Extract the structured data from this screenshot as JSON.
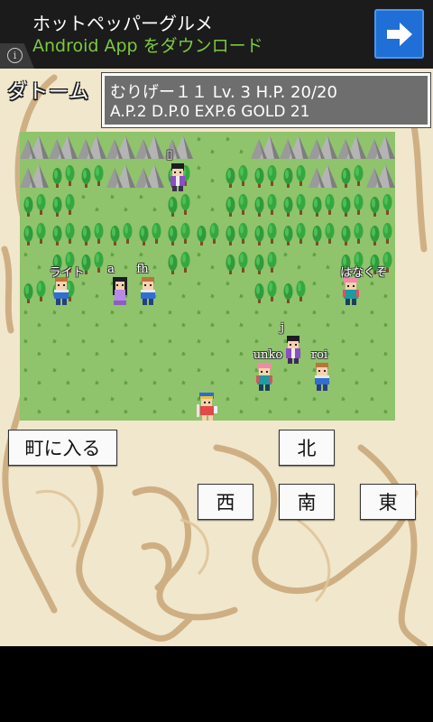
{
  "ad": {
    "title": "ホットペッパーグルメ",
    "subtitle": "Android App をダウンロード",
    "info_icon": "info-icon",
    "download_icon": "arrow-right-icon"
  },
  "town_name": "ダトーム",
  "status": {
    "line1": "むりげー１１  Lv.  3  H.P. 20/20",
    "line2": "A.P.2 D.P.0 EXP.6 GOLD 21"
  },
  "characters": [
    {
      "name": "▯",
      "sprite": "dark-hair-purple"
    },
    {
      "name": "ライト",
      "sprite": "blond-blue"
    },
    {
      "name": "a",
      "sprite": "long-hair-purple"
    },
    {
      "name": "fh",
      "sprite": "blond-blue"
    },
    {
      "name": "はなくそ",
      "sprite": "pink-hair-teal"
    },
    {
      "name": "j",
      "sprite": "dark-hair-purple"
    },
    {
      "name": "unko",
      "sprite": "pink-hair-teal"
    },
    {
      "name": "roi",
      "sprite": "blond-blue"
    },
    {
      "name": "",
      "sprite": "player-hero"
    }
  ],
  "buttons": {
    "enter_town": "町に入る",
    "north": "北",
    "west": "西",
    "south": "南",
    "east": "東"
  },
  "colors": {
    "grass": "#8fc36c",
    "parchment": "#f1e7cc",
    "status_bg": "#6e6e6e",
    "ad_green": "#7cc940",
    "ad_blue": "#1f6fd6"
  }
}
